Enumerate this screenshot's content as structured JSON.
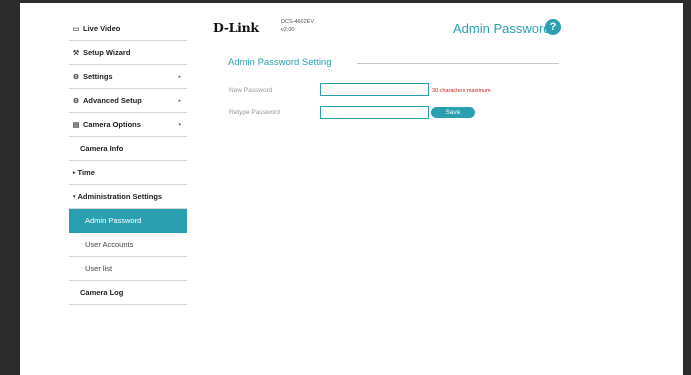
{
  "sidebar": {
    "items": [
      {
        "label": "Live Video",
        "icon": "live-video-icon",
        "glyph": "▭"
      },
      {
        "label": "Setup Wizard",
        "icon": "wand-icon",
        "glyph": "⚒"
      },
      {
        "label": "Settings",
        "icon": "gear-icon",
        "glyph": "⚙",
        "arrow": "▸"
      },
      {
        "label": "Advanced Setup",
        "icon": "gears-icon",
        "glyph": "⚙",
        "arrow": "▸"
      },
      {
        "label": "Camera Options",
        "icon": "camera-options-icon",
        "glyph": "▤",
        "arrow": "▾"
      }
    ],
    "camera_info": "Camera Info",
    "time": "Time",
    "admin_settings": "Administration Settings",
    "admin_password": "Admin Password",
    "user_accounts": "User Accounts",
    "user_list": "User list",
    "camera_log": "Camera Log"
  },
  "header": {
    "brand": "D-Link",
    "model": "DCS-4602EV",
    "version": "v2.00",
    "title": "Admin Password",
    "help": "?"
  },
  "form": {
    "section_title": "Admin Password Setting",
    "new_password_label": "New Password",
    "new_password_value": "",
    "retype_password_label": "Retype Password",
    "retype_password_value": "",
    "hint": "30 characters maximum",
    "save_label": "Save"
  },
  "colors": {
    "accent": "#2a9fb0",
    "hint": "#d02020",
    "frame": "#2b2b2b"
  }
}
